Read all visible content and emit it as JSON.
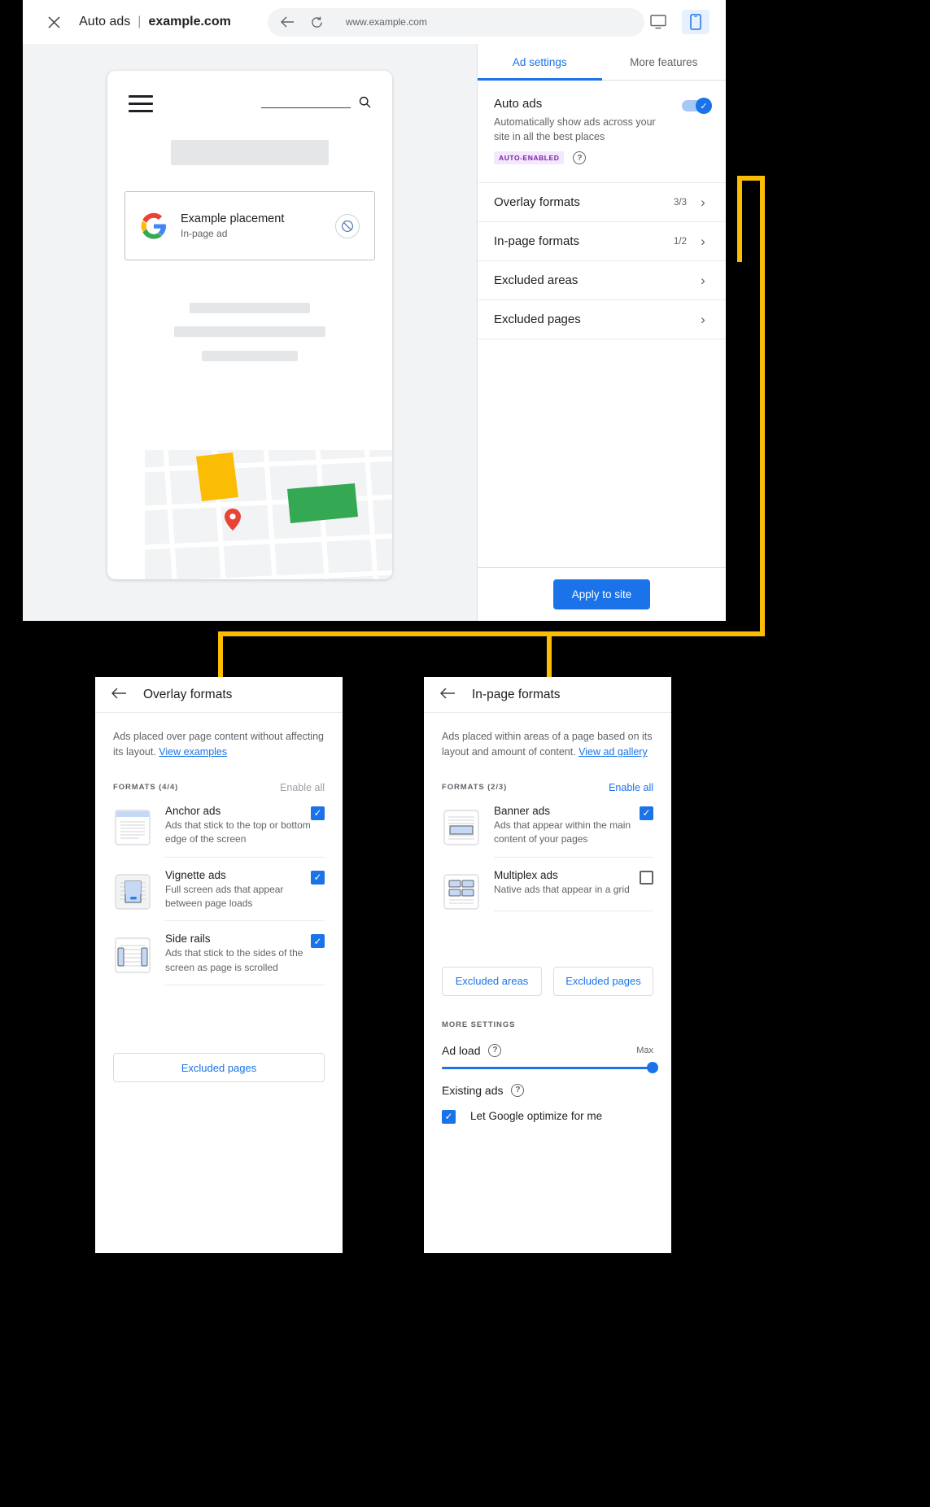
{
  "browser": {
    "close_icon": "close-icon",
    "app_title": "Auto ads",
    "separator": "|",
    "site_domain": "example.com",
    "back_icon": "back-arrow-icon",
    "reload_icon": "reload-icon",
    "url": "www.example.com",
    "desktop_icon": "desktop-preview-icon",
    "mobile_icon": "mobile-preview-icon"
  },
  "preview": {
    "menu_icon": "hamburger-menu-icon",
    "search_icon": "search-icon",
    "placement_title": "Example placement",
    "placement_subtitle": "In-page ad",
    "google_logo": "google-logo-icon",
    "block_icon": "block-ad-icon",
    "map_pin": "map-pin-icon"
  },
  "settings": {
    "tabs": [
      {
        "label": "Ad settings",
        "selected": true
      },
      {
        "label": "More features",
        "selected": false
      }
    ],
    "auto_ads": {
      "title": "Auto ads",
      "description": "Automatically show ads across your site in all the best places",
      "badge": "AUTO-ENABLED",
      "help_icon": "help-circle-icon",
      "toggle_on": true,
      "toggle_icon": "check-icon"
    },
    "rows": [
      {
        "label": "Overlay formats",
        "count": "3/3",
        "chevron": "chevron-right-icon"
      },
      {
        "label": "In-page formats",
        "count": "1/2",
        "chevron": "chevron-right-icon"
      },
      {
        "label": "Excluded areas",
        "count": "",
        "chevron": "chevron-right-icon"
      },
      {
        "label": "Excluded pages",
        "count": "",
        "chevron": "chevron-right-icon"
      }
    ],
    "apply_label": "Apply to site"
  },
  "overlay_card": {
    "back_icon": "back-arrow-icon",
    "title": "Overlay formats",
    "intro": "Ads placed over page content without affecting its layout. ",
    "intro_link": "View examples",
    "formats_label": "FORMATS (4/4)",
    "enable_all": "Enable all",
    "enable_all_active": false,
    "items": [
      {
        "name": "Anchor ads",
        "desc": "Ads that stick to the top or bottom edge of the screen",
        "checked": true,
        "icon": "anchor-ads-thumbnail"
      },
      {
        "name": "Vignette ads",
        "desc": "Full screen ads that appear between page loads",
        "checked": true,
        "icon": "vignette-ads-thumbnail"
      },
      {
        "name": "Side rails",
        "desc": "Ads that stick to the sides of the screen as page is scrolled",
        "checked": true,
        "icon": "side-rails-thumbnail"
      }
    ],
    "excluded_pages_button": "Excluded pages"
  },
  "inpage_card": {
    "back_icon": "back-arrow-icon",
    "title": "In-page formats",
    "intro": "Ads placed within areas of a page based on its layout and amount of content. ",
    "intro_link": "View ad gallery",
    "formats_label": "FORMATS (2/3)",
    "enable_all": "Enable all",
    "enable_all_active": true,
    "items": [
      {
        "name": "Banner ads",
        "desc": "Ads that appear within the main content of your pages",
        "checked": true,
        "icon": "banner-ads-thumbnail"
      },
      {
        "name": "Multiplex ads",
        "desc": "Native ads that appear in a grid",
        "checked": false,
        "icon": "multiplex-ads-thumbnail"
      }
    ],
    "excluded_areas_button": "Excluded areas",
    "excluded_pages_button": "Excluded pages",
    "more_settings_label": "MORE SETTINGS",
    "ad_load": {
      "title": "Ad load",
      "help_icon": "help-circle-icon",
      "max_label": "Max",
      "value": 100
    },
    "existing_ads": {
      "title": "Existing ads",
      "help_icon": "help-circle-icon",
      "checkbox_label": "Let Google optimize for me",
      "checked": true
    }
  },
  "colors": {
    "accent": "#1a73e8",
    "connector": "#fbbc04",
    "badge_bg": "#f3e8fd",
    "badge_fg": "#7b1fa2"
  }
}
